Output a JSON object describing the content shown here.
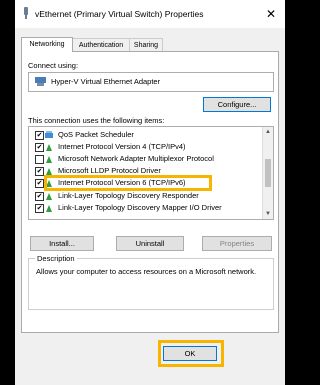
{
  "window": {
    "title": "vEthernet (Primary Virtual Switch) Properties",
    "close_glyph": "✕"
  },
  "tabs": [
    {
      "label": "Networking",
      "active": true
    },
    {
      "label": "Authentication",
      "active": false
    },
    {
      "label": "Sharing",
      "active": false
    }
  ],
  "connect_using": {
    "label": "Connect using:",
    "adapter": "Hyper-V Virtual Ethernet Adapter"
  },
  "configure_button": "Configure...",
  "items_label": "This connection uses the following items:",
  "items": [
    {
      "label": "QoS Packet Scheduler",
      "checked": true,
      "icon": "scheduler-icon"
    },
    {
      "label": "Internet Protocol Version 4 (TCP/IPv4)",
      "checked": true,
      "icon": "protocol-icon"
    },
    {
      "label": "Microsoft Network Adapter Multiplexor Protocol",
      "checked": false,
      "icon": "protocol-icon"
    },
    {
      "label": "Microsoft LLDP Protocol Driver",
      "checked": true,
      "icon": "protocol-icon"
    },
    {
      "label": "Internet Protocol Version 6 (TCP/IPv6)",
      "checked": true,
      "icon": "protocol-icon",
      "highlighted": true
    },
    {
      "label": "Link-Layer Topology Discovery Responder",
      "checked": true,
      "icon": "protocol-icon"
    },
    {
      "label": "Link-Layer Topology Discovery Mapper I/O Driver",
      "checked": true,
      "icon": "protocol-icon"
    }
  ],
  "buttons": {
    "install": "Install...",
    "uninstall": "Uninstall",
    "properties": "Properties",
    "ok": "OK"
  },
  "description": {
    "legend": "Description",
    "text": "Allows your computer to access resources on a Microsoft network."
  },
  "colors": {
    "highlight": "#f7b500",
    "protocol_icon": "#2e9e3e",
    "focus": "#0078d7"
  }
}
